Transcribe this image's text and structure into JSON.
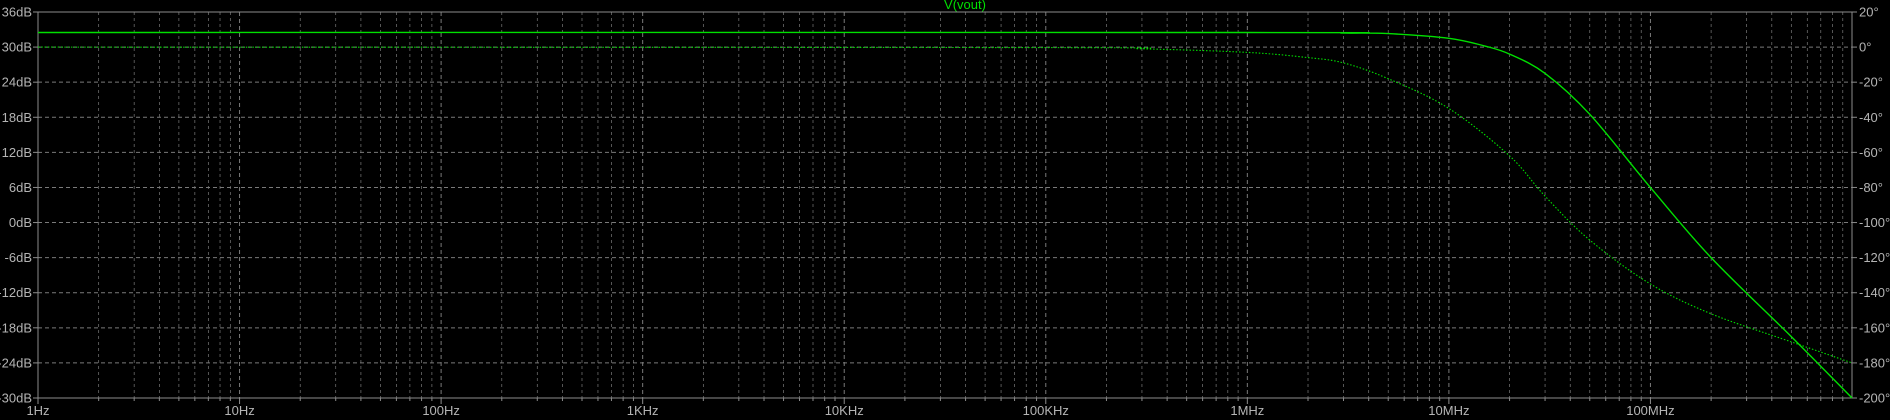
{
  "chart_data": {
    "type": "line",
    "title": "V(vout)",
    "x_scale": "log",
    "xlim_hz": [
      1,
      1000000000
    ],
    "x_ticks": [
      {
        "value": 1,
        "label": "1Hz"
      },
      {
        "value": 10,
        "label": "10Hz"
      },
      {
        "value": 100,
        "label": "100Hz"
      },
      {
        "value": 1000,
        "label": "1KHz"
      },
      {
        "value": 10000,
        "label": "10KHz"
      },
      {
        "value": 100000,
        "label": "100KHz"
      },
      {
        "value": 1000000,
        "label": "1MHz"
      },
      {
        "value": 10000000,
        "label": "10MHz"
      },
      {
        "value": 100000000,
        "label": "100MHz"
      }
    ],
    "y_left": {
      "unit": "dB",
      "ylim": [
        -30,
        36
      ],
      "ticks": [
        {
          "value": 36,
          "label": "36dB"
        },
        {
          "value": 30,
          "label": "30dB"
        },
        {
          "value": 24,
          "label": "24dB"
        },
        {
          "value": 18,
          "label": "18dB"
        },
        {
          "value": 12,
          "label": "12dB"
        },
        {
          "value": 6,
          "label": "6dB"
        },
        {
          "value": 0,
          "label": "0dB"
        },
        {
          "value": -6,
          "label": "-6dB"
        },
        {
          "value": -12,
          "label": "-12dB"
        },
        {
          "value": -18,
          "label": "-18dB"
        },
        {
          "value": -24,
          "label": "-24dB"
        },
        {
          "value": -30,
          "label": "-30dB"
        }
      ]
    },
    "y_right": {
      "unit": "°",
      "ylim": [
        -200,
        20
      ],
      "ticks": [
        {
          "value": 20,
          "label": "20°"
        },
        {
          "value": 0,
          "label": "0°"
        },
        {
          "value": -20,
          "label": "-20°"
        },
        {
          "value": -40,
          "label": "-40°"
        },
        {
          "value": -60,
          "label": "-60°"
        },
        {
          "value": -80,
          "label": "-80°"
        },
        {
          "value": -100,
          "label": "-100°"
        },
        {
          "value": -120,
          "label": "-120°"
        },
        {
          "value": -140,
          "label": "-140°"
        },
        {
          "value": -160,
          "label": "-160°"
        },
        {
          "value": -180,
          "label": "-180°"
        },
        {
          "value": -200,
          "label": "-200°"
        }
      ]
    },
    "grid": true,
    "series": [
      {
        "kind": "magnitude",
        "axis": "left",
        "style": "solid",
        "points": [
          [
            1,
            32.5
          ],
          [
            1000000,
            32.5
          ],
          [
            3000000,
            32.4
          ],
          [
            5000000,
            32.3
          ],
          [
            10000000,
            31.5
          ],
          [
            15000000,
            30.2
          ],
          [
            20000000,
            28.8
          ],
          [
            30000000,
            25.5
          ],
          [
            50000000,
            18.5
          ],
          [
            100000000,
            6
          ],
          [
            200000000,
            -6
          ],
          [
            500000000,
            -19.5
          ],
          [
            1000000000,
            -30
          ]
        ]
      },
      {
        "kind": "phase",
        "axis": "right",
        "style": "dotted",
        "points": [
          [
            1,
            0
          ],
          [
            100000,
            -0.3
          ],
          [
            300000,
            -1
          ],
          [
            1000000,
            -3
          ],
          [
            2000000,
            -6
          ],
          [
            3000000,
            -9
          ],
          [
            5000000,
            -18
          ],
          [
            10000000,
            -35
          ],
          [
            20000000,
            -62
          ],
          [
            30000000,
            -85
          ],
          [
            50000000,
            -110
          ],
          [
            100000000,
            -135
          ],
          [
            200000000,
            -152
          ],
          [
            500000000,
            -168
          ],
          [
            1000000000,
            -180
          ]
        ]
      }
    ],
    "colors": {
      "background": "#000000",
      "trace": "#00e000",
      "grid": "#7a7a7a",
      "axis": "#8c8c8c",
      "tick_text": "#b4b4b4"
    }
  }
}
